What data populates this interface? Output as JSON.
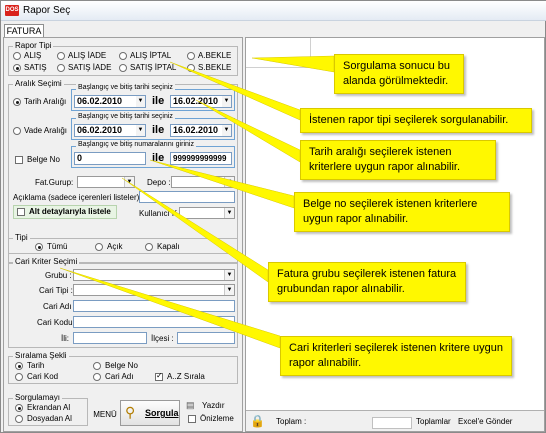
{
  "window": {
    "title": "Rapor Seç",
    "app_icon": "DOS"
  },
  "tabs": [
    {
      "label": "FATURA"
    }
  ],
  "rapor_tipi": {
    "label": "Rapor Tipi",
    "options": [
      {
        "label": "ALIŞ",
        "selected": false
      },
      {
        "label": "ALIŞ İADE",
        "selected": false
      },
      {
        "label": "ALIŞ İPTAL",
        "selected": false
      },
      {
        "label": "A.BEKLE",
        "selected": false
      },
      {
        "label": "SATIŞ",
        "selected": true
      },
      {
        "label": "SATIŞ İADE",
        "selected": false
      },
      {
        "label": "SATIŞ İPTAL",
        "selected": false
      },
      {
        "label": "S.BEKLE",
        "selected": false
      }
    ]
  },
  "aralik": {
    "label": "Aralık Seçimi",
    "tarih": {
      "radio_label": "Tarih Aralığı",
      "selected": true,
      "box_label": "Başlangıç ve bitiş tarihi seçiniz",
      "start": "06.02.2010",
      "sep": "ile",
      "end": "16.02.2010"
    },
    "vade": {
      "radio_label": "Vade Aralığı",
      "selected": false,
      "box_label": "Başlangıç ve bitiş tarihi seçiniz",
      "start": "06.02.2010",
      "sep": "ile",
      "end": "16.02.2010"
    },
    "belge": {
      "check_label": "Belge No",
      "box_label": "Başlangıç ve bitiş numaralarını giriniz",
      "start": "0",
      "sep": "ile",
      "end": "999999999999"
    },
    "fat_grubu_label": "Fat.Gurup:",
    "depo_label": "Depo :",
    "aciklama_label": "Açıklama (sadece içerenleri listeler) :",
    "alt_detay_label": "Alt detaylarıyla listele",
    "kullanici_label": "Kullanıcı K.:"
  },
  "tipi": {
    "label": "Tipi",
    "options": [
      {
        "label": "Tümü",
        "selected": true
      },
      {
        "label": "Açık",
        "selected": false
      },
      {
        "label": "Kapalı",
        "selected": false
      }
    ]
  },
  "cari": {
    "label": "Cari Kriter Seçimi",
    "fields": {
      "grubu": "Grubu :",
      "tipi": "Cari Tipi :",
      "adi": "Cari Adı",
      "kodu": "Cari Kodu",
      "il": "İli:",
      "ilcesi": "İlçesi :"
    }
  },
  "siralama": {
    "label": "Sıralama Şekli",
    "options": [
      {
        "label": "Tarih",
        "selected": true
      },
      {
        "label": "Belge No",
        "selected": false
      },
      {
        "label": "Cari Kod",
        "selected": false
      },
      {
        "label": "Cari Adı",
        "selected": false
      }
    ],
    "az_label": "A..Z Sırala",
    "az_checked": true
  },
  "sorgulamayi": {
    "label": "Sorgulamayı",
    "options": [
      {
        "label": "Ekrandan Al",
        "selected": true
      },
      {
        "label": "Dosyadan Al",
        "selected": false
      }
    ]
  },
  "buttons": {
    "menu": "MENÜ",
    "sorgula": "Sorgula",
    "yazdir": "Yazdır",
    "onizleme": "Önizleme"
  },
  "result_footer": {
    "toplam": "Toplam :",
    "toplamlar": "Toplamlar",
    "excel": "Excel'e Gönder"
  },
  "callouts": [
    "Sorgulama sonucu bu alanda görülmektedir.",
    "İstenen rapor tipi seçilerek sorgulanabilir.",
    "Tarih aralığı seçilerek istenen kriterlere uygun rapor alınabilir.",
    "Belge no seçilerek istenen kriterlere uygun rapor alınabilir.",
    "Fatura grubu seçilerek istenen fatura grubundan rapor alınabilir.",
    "Cari kriterleri seçilerek istenen kritere uygun rapor alınabilir."
  ],
  "colors": {
    "callout": "#fff800",
    "title_bg": "#e4ebf4",
    "accent_border": "#6fa3d4"
  }
}
